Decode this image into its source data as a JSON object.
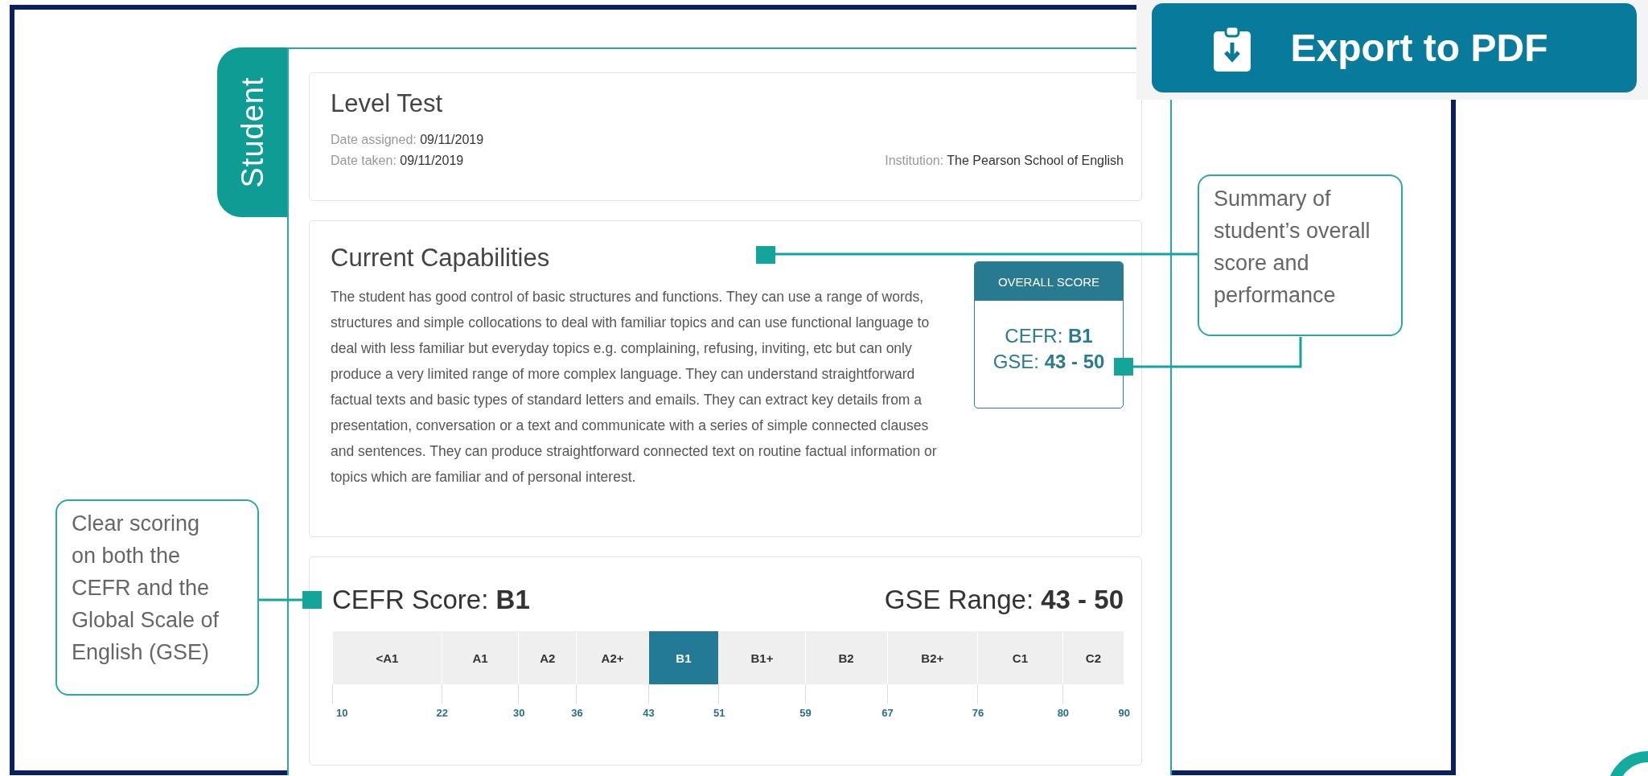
{
  "export_button": {
    "label": "Export to PDF"
  },
  "section_tab": "Student",
  "test_card": {
    "title": "Level Test",
    "date_assigned": "Date assigned: **09/11/2019**",
    "date_taken": "Date taken: **09/11/2019**",
    "institution": "Institution: **The Pearson School of English**"
  },
  "capabilities": {
    "title": "Current Capabilities",
    "text": "The student has good control of basic structures and functions. They can use a range of words, structures and simple collocations to deal with familiar topics and can use functional language to deal with less familiar but everyday topics e.g. complaining, refusing, inviting, etc but can only produce a very limited range of more complex language. They can understand straightforward factual texts and basic types of standard letters and emails. They can extract key details from a presentation, conversation or a text and communicate with a series of simple connected clauses and sentences. They can produce straightforward connected text on routine factual information or topics which are familiar and of personal interest.",
    "overall_score": {
      "heading": "OVERALL SCORE",
      "cefr": "CEFR: **B1**",
      "gse": "GSE: **43 - 50**"
    }
  },
  "score_card": {
    "cefr": "CEFR Score: **B1**",
    "gse": "GSE Range: **43 - 50**",
    "levels": [
      {
        "label": "<A1",
        "selected": false
      },
      {
        "label": "A1",
        "selected": false
      },
      {
        "label": "A2",
        "selected": false
      },
      {
        "label": "A2+",
        "selected": false
      },
      {
        "label": "B1",
        "selected": true
      },
      {
        "label": "B1+",
        "selected": false
      },
      {
        "label": "B2",
        "selected": false
      },
      {
        "label": "B2+",
        "selected": false
      },
      {
        "label": "C1",
        "selected": false
      },
      {
        "label": "C2",
        "selected": false
      }
    ],
    "ticks": [
      "10",
      "22",
      "30",
      "36",
      "43",
      "51",
      "59",
      "67",
      "76",
      "80",
      "90"
    ]
  },
  "callouts": [
    {
      "text": "Summary of student’s overall score and performance"
    },
    {
      "text": "Clear scoring on both the CEFR and the Global Scale of English (GSE)"
    }
  ]
}
